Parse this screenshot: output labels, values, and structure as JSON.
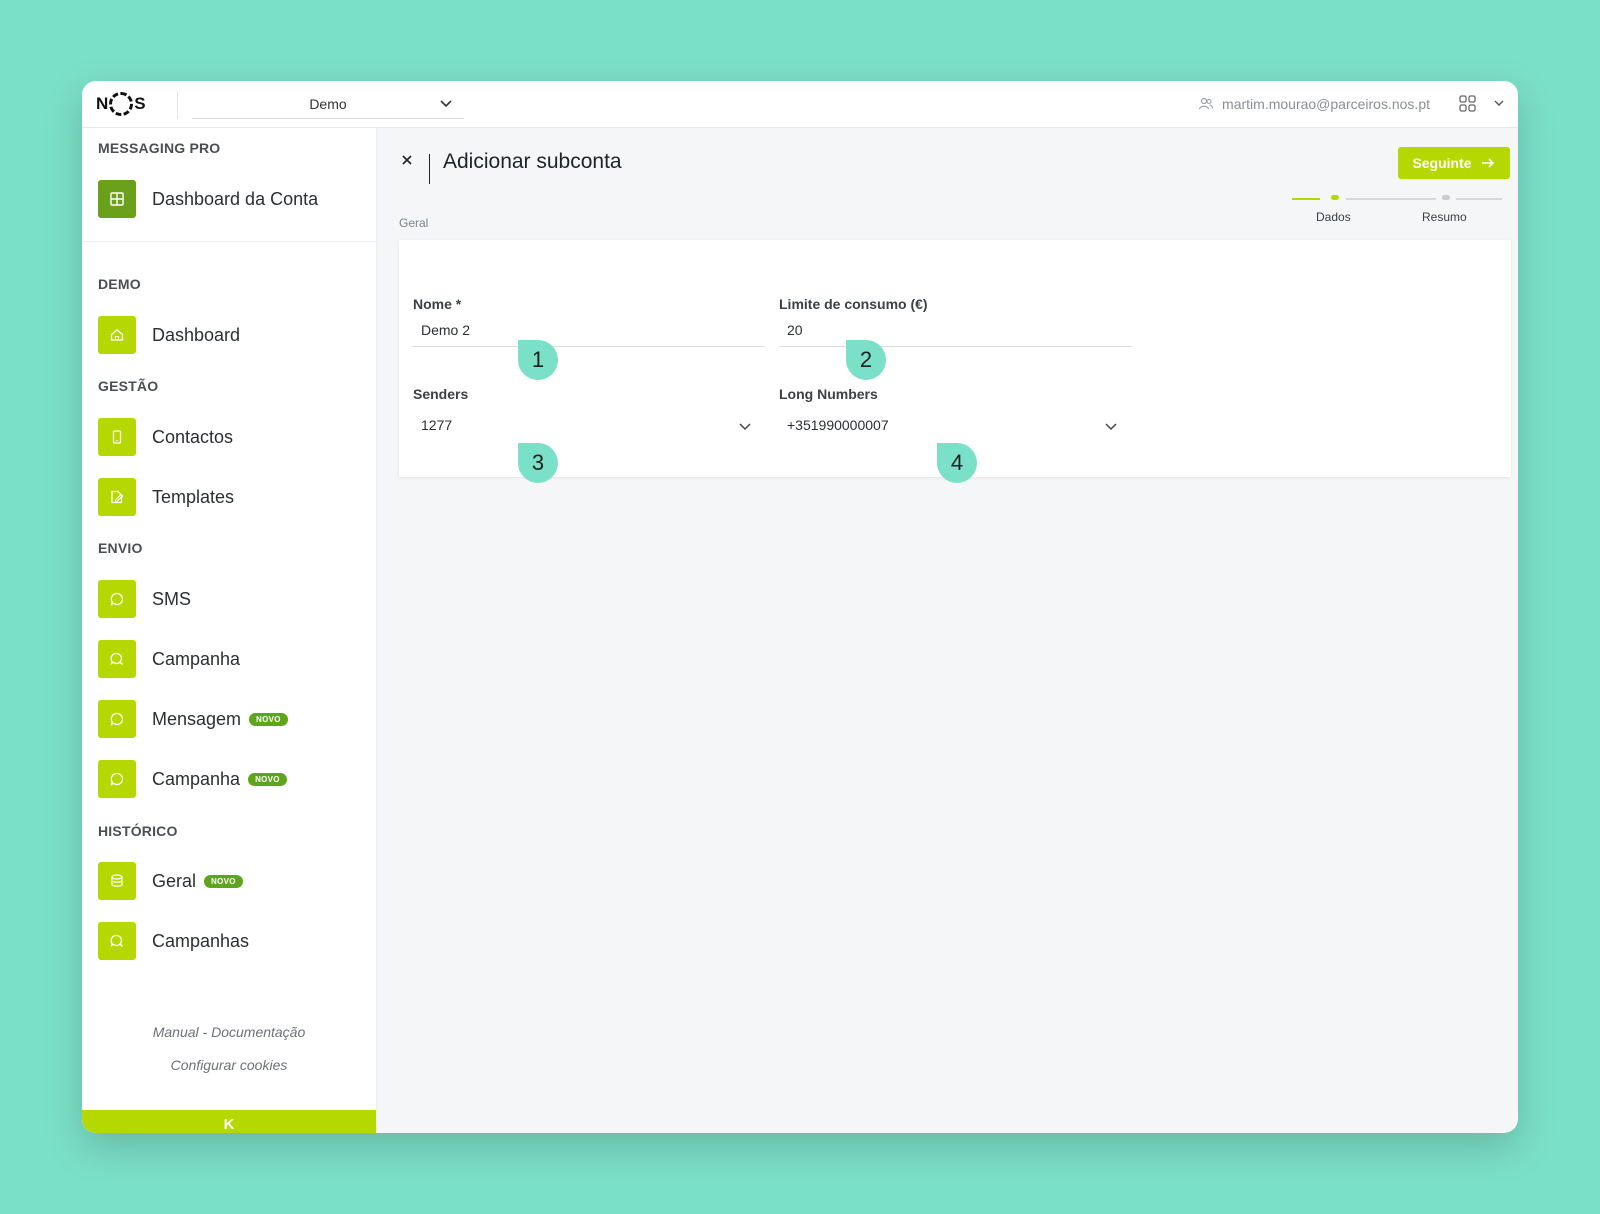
{
  "brand": {
    "logo_left": "N",
    "logo_right": "S"
  },
  "topbar": {
    "account_selected": "Demo",
    "user_email": "martim.mourao@parceiros.nos.pt"
  },
  "sidebar": {
    "sections": {
      "messaging_pro": "MESSAGING PRO",
      "demo": "DEMO",
      "gestao": "GESTÃO",
      "envio": "ENVIO",
      "historico": "HISTÓRICO"
    },
    "items": [
      {
        "label": "Dashboard da Conta",
        "icon": "grid-icon"
      },
      {
        "label": "Dashboard",
        "icon": "home-icon"
      },
      {
        "label": "Contactos",
        "icon": "phone-icon"
      },
      {
        "label": "Templates",
        "icon": "edit-icon"
      },
      {
        "label": "SMS",
        "icon": "chat-icon"
      },
      {
        "label": "Campanha",
        "icon": "chat-search-icon"
      },
      {
        "label": "Mensagem",
        "icon": "chat-icon",
        "badge": "NOVO"
      },
      {
        "label": "Campanha",
        "icon": "chat-icon",
        "badge": "NOVO"
      },
      {
        "label": "Geral",
        "icon": "database-icon",
        "badge": "NOVO"
      },
      {
        "label": "Campanhas",
        "icon": "chat-search-icon"
      }
    ],
    "footer": {
      "manual": "Manual - Documentação",
      "cookies": "Configurar cookies"
    },
    "collapse_glyph": "K"
  },
  "main": {
    "title": "Adicionar subconta",
    "next_label": "Seguinte",
    "breadcrumb": "Geral",
    "steps": [
      {
        "label": "Dados",
        "state": "active"
      },
      {
        "label": "Resumo",
        "state": "pending"
      }
    ],
    "form": {
      "nome_label": "Nome *",
      "nome_value": "Demo 2",
      "limite_label": "Limite de consumo (€)",
      "limite_value": "20",
      "senders_label": "Senders",
      "senders_value": "1277",
      "long_numbers_label": "Long Numbers",
      "long_numbers_value": "+351990000007"
    }
  },
  "markers": [
    "1",
    "2",
    "3",
    "4"
  ],
  "colors": {
    "background": "#7be0c8",
    "accent": "#b5d900",
    "badge": "#5fa51b",
    "marker": "#7be0c8"
  }
}
